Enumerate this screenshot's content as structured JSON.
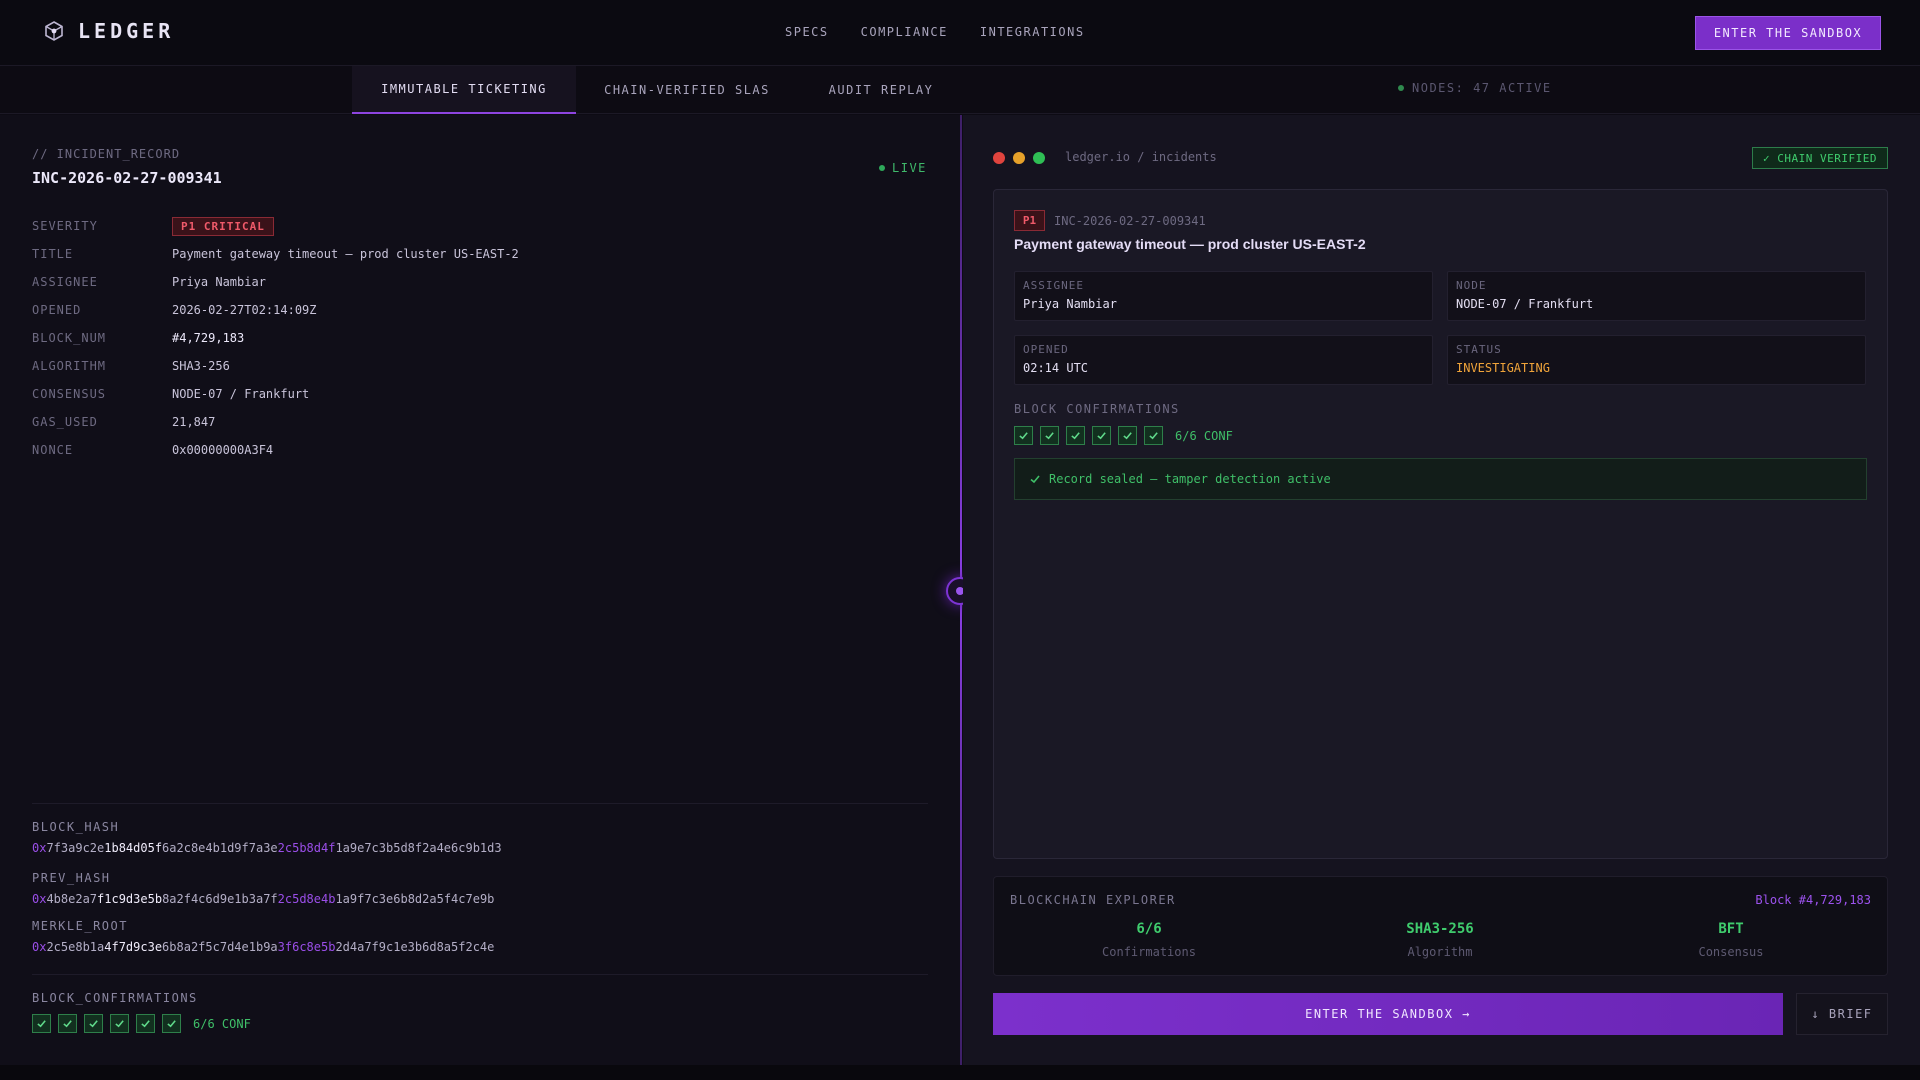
{
  "header": {
    "logo_text": "LEDGER",
    "logo_icon": "cog-cube-icon",
    "nav": [
      "SPECS",
      "COMPLIANCE",
      "INTEGRATIONS"
    ],
    "cta_label": "ENTER THE SANDBOX"
  },
  "tabs": {
    "items": [
      "IMMUTABLE TICKETING",
      "CHAIN-VERIFIED SLAS",
      "AUDIT REPLAY"
    ],
    "active_index": 0,
    "nodes_status": "NODES: 47 ACTIVE"
  },
  "left": {
    "record_label": "// INCIDENT_RECORD",
    "record_id": "INC-2026-02-27-009341",
    "live_label": "LIVE",
    "fields": {
      "severity": {
        "key": "SEVERITY",
        "value": "P1 CRITICAL"
      },
      "title": {
        "key": "TITLE",
        "value": "Payment gateway timeout — prod cluster US-EAST-2"
      },
      "assignee": {
        "key": "ASSIGNEE",
        "value": "Priya Nambiar"
      },
      "opened": {
        "key": "OPENED",
        "value": "2026-02-27T02:14:09Z"
      },
      "block_num": {
        "key": "BLOCK_NUM",
        "value": "#4,729,183"
      },
      "algorithm": {
        "key": "ALGORITHM",
        "value": "SHA3-256"
      },
      "consensus": {
        "key": "CONSENSUS",
        "value": "NODE-07 / Frankfurt"
      },
      "gas_used": {
        "key": "GAS_USED",
        "value": "21,847"
      },
      "nonce": {
        "key": "NONCE",
        "value": "0x00000000A3F4"
      }
    },
    "hashes": {
      "block_hash": {
        "label": "BLOCK_HASH",
        "prefix": "0x",
        "a": "7f3a9c2e",
        "b": "1b84d05f",
        "c": "6a2c8e4b1d9f7a3e",
        "d": "2c5b8d4f",
        "e": "1a9e7c3b5d8f2a4e6c9b1d3"
      },
      "prev_hash": {
        "label": "PREV_HASH",
        "prefix": "0x",
        "a": "4b8e2a7",
        "b": "f1c9d3e5b",
        "c": "8a2f4c6d9e1b3a7f",
        "d": "2c5d8e4b",
        "e": "1a9f7c3e6b8d2a5f4c7e9b"
      },
      "merkle_root": {
        "label": "MERKLE_ROOT",
        "prefix": "0x",
        "a": "2c5e8b1a",
        "b": "4f7d9c3e",
        "c": "6b8a2f5c7d4e1b9a",
        "d": "3f6c8e5b",
        "e": "2d4a7f9c1e3b6d8a5f2c4e"
      }
    },
    "confirmations_label": "BLOCK_CONFIRMATIONS",
    "confirmations_count": 6,
    "confirmations_text": "6/6 CONF"
  },
  "right": {
    "window_url": "ledger.io / incidents",
    "verified_badge": "✓ CHAIN VERIFIED",
    "card": {
      "priority": "P1",
      "id": "INC-2026-02-27-009341",
      "title": "Payment gateway timeout — prod cluster US-EAST-2",
      "assignee": {
        "key": "ASSIGNEE",
        "value": "Priya Nambiar"
      },
      "node": {
        "key": "NODE",
        "value": "NODE-07 / Frankfurt"
      },
      "opened": {
        "key": "OPENED",
        "value": "02:14 UTC"
      },
      "status": {
        "key": "STATUS",
        "value": "INVESTIGATING"
      },
      "confirmations_label": "BLOCK CONFIRMATIONS",
      "confirmations_count": 6,
      "confirmations_text": "6/6 CONF",
      "sealed_text": "Record sealed — tamper detection active"
    },
    "explorer": {
      "title": "BLOCKCHAIN EXPLORER",
      "block": "Block #4,729,183",
      "stats": [
        {
          "value": "6/6",
          "label": "Confirmations"
        },
        {
          "value": "SHA3-256",
          "label": "Algorithm"
        },
        {
          "value": "BFT",
          "label": "Consensus"
        }
      ]
    },
    "cta_label": "ENTER THE SANDBOX →",
    "brief_label": "↓ BRIEF"
  },
  "colors": {
    "accent": "#7b2fc9",
    "success": "#3fcc6d",
    "danger": "#f05a6a",
    "warning": "#f0a43a"
  }
}
